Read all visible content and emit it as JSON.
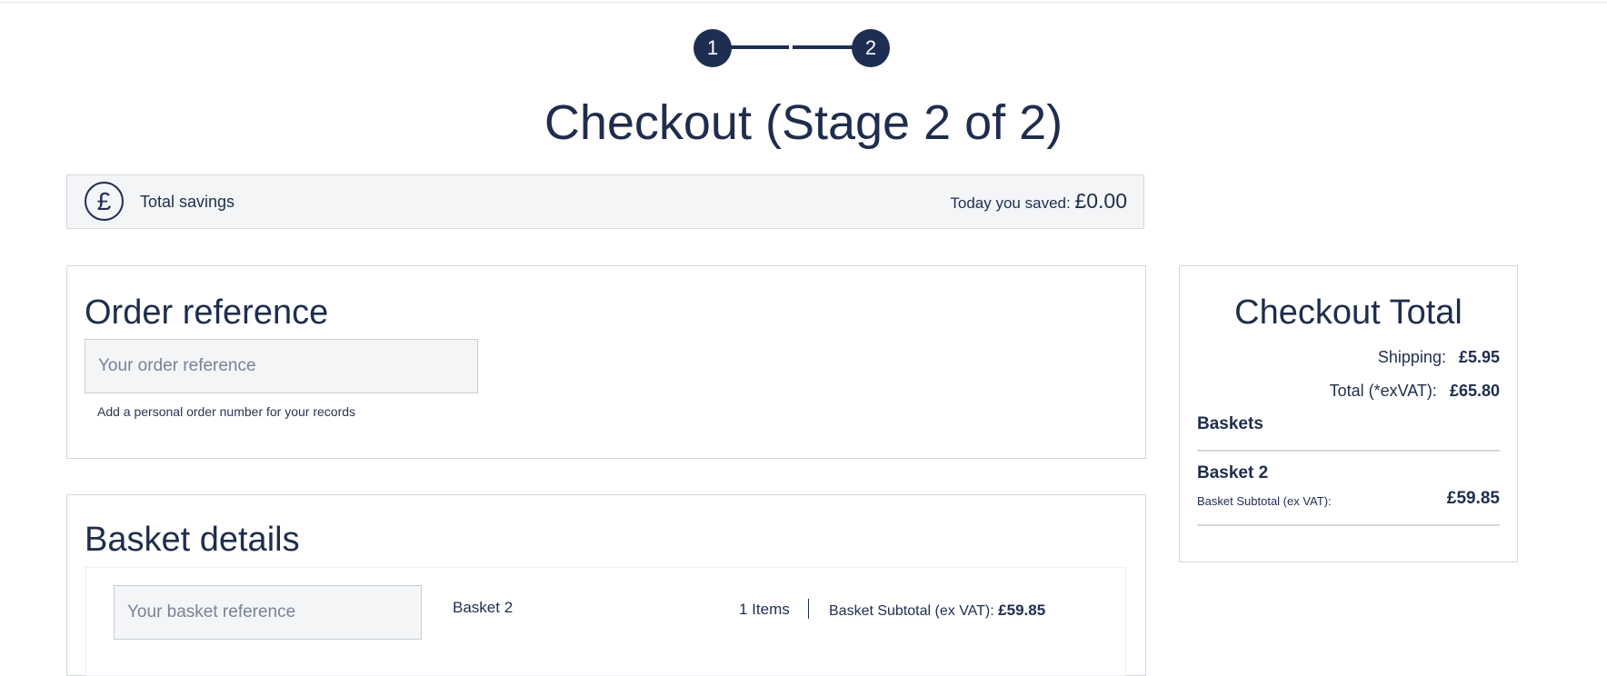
{
  "stepper": {
    "steps": [
      "1",
      "2"
    ],
    "current_step": 2
  },
  "page": {
    "title": "Checkout (Stage 2 of 2)"
  },
  "savings": {
    "icon": "pound-icon",
    "icon_glyph": "£",
    "label": "Total savings",
    "today_label": "Today you saved:",
    "amount": "£0.00"
  },
  "order_reference": {
    "title": "Order reference",
    "placeholder": "Your order reference",
    "value": "",
    "help": "Add a personal order number for your records"
  },
  "basket_details": {
    "title": "Basket details",
    "rows": [
      {
        "reference_placeholder": "Your basket reference",
        "name": "Basket 2",
        "items": "1 Items",
        "subtotal_label": "Basket Subtotal (ex VAT):",
        "subtotal_value": "£59.85"
      }
    ]
  },
  "checkout_total": {
    "title": "Checkout Total",
    "shipping_label": "Shipping:",
    "shipping_value": "£5.95",
    "total_label": "Total (*exVAT):",
    "total_value": "£65.80",
    "baskets_heading": "Baskets",
    "baskets": [
      {
        "name": "Basket 2",
        "subtotal_label": "Basket Subtotal (ex VAT):",
        "subtotal_value": "£59.85"
      }
    ]
  },
  "colors": {
    "primary": "#1f2d52",
    "panel_bg": "#f3f5f7",
    "border": "#d4d8de",
    "text": "#1f2d4d"
  }
}
